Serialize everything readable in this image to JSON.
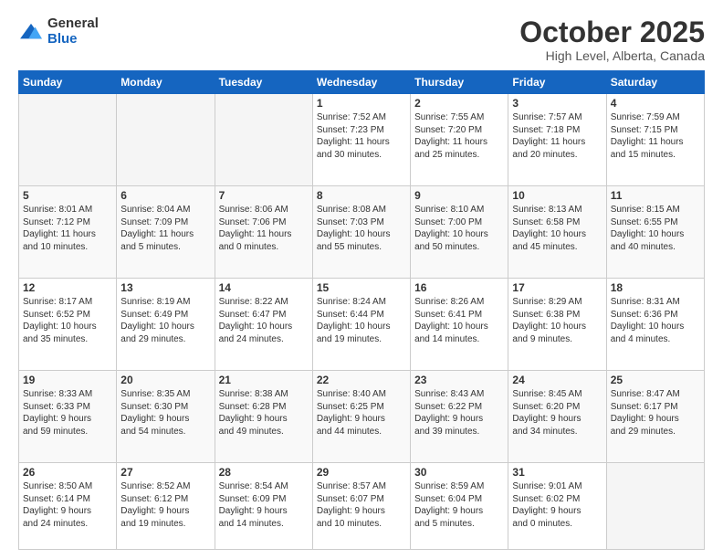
{
  "header": {
    "logo_line1": "General",
    "logo_line2": "Blue",
    "month": "October 2025",
    "location": "High Level, Alberta, Canada"
  },
  "weekdays": [
    "Sunday",
    "Monday",
    "Tuesday",
    "Wednesday",
    "Thursday",
    "Friday",
    "Saturday"
  ],
  "weeks": [
    [
      {
        "day": "",
        "info": ""
      },
      {
        "day": "",
        "info": ""
      },
      {
        "day": "",
        "info": ""
      },
      {
        "day": "1",
        "info": "Sunrise: 7:52 AM\nSunset: 7:23 PM\nDaylight: 11 hours\nand 30 minutes."
      },
      {
        "day": "2",
        "info": "Sunrise: 7:55 AM\nSunset: 7:20 PM\nDaylight: 11 hours\nand 25 minutes."
      },
      {
        "day": "3",
        "info": "Sunrise: 7:57 AM\nSunset: 7:18 PM\nDaylight: 11 hours\nand 20 minutes."
      },
      {
        "day": "4",
        "info": "Sunrise: 7:59 AM\nSunset: 7:15 PM\nDaylight: 11 hours\nand 15 minutes."
      }
    ],
    [
      {
        "day": "5",
        "info": "Sunrise: 8:01 AM\nSunset: 7:12 PM\nDaylight: 11 hours\nand 10 minutes."
      },
      {
        "day": "6",
        "info": "Sunrise: 8:04 AM\nSunset: 7:09 PM\nDaylight: 11 hours\nand 5 minutes."
      },
      {
        "day": "7",
        "info": "Sunrise: 8:06 AM\nSunset: 7:06 PM\nDaylight: 11 hours\nand 0 minutes."
      },
      {
        "day": "8",
        "info": "Sunrise: 8:08 AM\nSunset: 7:03 PM\nDaylight: 10 hours\nand 55 minutes."
      },
      {
        "day": "9",
        "info": "Sunrise: 8:10 AM\nSunset: 7:00 PM\nDaylight: 10 hours\nand 50 minutes."
      },
      {
        "day": "10",
        "info": "Sunrise: 8:13 AM\nSunset: 6:58 PM\nDaylight: 10 hours\nand 45 minutes."
      },
      {
        "day": "11",
        "info": "Sunrise: 8:15 AM\nSunset: 6:55 PM\nDaylight: 10 hours\nand 40 minutes."
      }
    ],
    [
      {
        "day": "12",
        "info": "Sunrise: 8:17 AM\nSunset: 6:52 PM\nDaylight: 10 hours\nand 35 minutes."
      },
      {
        "day": "13",
        "info": "Sunrise: 8:19 AM\nSunset: 6:49 PM\nDaylight: 10 hours\nand 29 minutes."
      },
      {
        "day": "14",
        "info": "Sunrise: 8:22 AM\nSunset: 6:47 PM\nDaylight: 10 hours\nand 24 minutes."
      },
      {
        "day": "15",
        "info": "Sunrise: 8:24 AM\nSunset: 6:44 PM\nDaylight: 10 hours\nand 19 minutes."
      },
      {
        "day": "16",
        "info": "Sunrise: 8:26 AM\nSunset: 6:41 PM\nDaylight: 10 hours\nand 14 minutes."
      },
      {
        "day": "17",
        "info": "Sunrise: 8:29 AM\nSunset: 6:38 PM\nDaylight: 10 hours\nand 9 minutes."
      },
      {
        "day": "18",
        "info": "Sunrise: 8:31 AM\nSunset: 6:36 PM\nDaylight: 10 hours\nand 4 minutes."
      }
    ],
    [
      {
        "day": "19",
        "info": "Sunrise: 8:33 AM\nSunset: 6:33 PM\nDaylight: 9 hours\nand 59 minutes."
      },
      {
        "day": "20",
        "info": "Sunrise: 8:35 AM\nSunset: 6:30 PM\nDaylight: 9 hours\nand 54 minutes."
      },
      {
        "day": "21",
        "info": "Sunrise: 8:38 AM\nSunset: 6:28 PM\nDaylight: 9 hours\nand 49 minutes."
      },
      {
        "day": "22",
        "info": "Sunrise: 8:40 AM\nSunset: 6:25 PM\nDaylight: 9 hours\nand 44 minutes."
      },
      {
        "day": "23",
        "info": "Sunrise: 8:43 AM\nSunset: 6:22 PM\nDaylight: 9 hours\nand 39 minutes."
      },
      {
        "day": "24",
        "info": "Sunrise: 8:45 AM\nSunset: 6:20 PM\nDaylight: 9 hours\nand 34 minutes."
      },
      {
        "day": "25",
        "info": "Sunrise: 8:47 AM\nSunset: 6:17 PM\nDaylight: 9 hours\nand 29 minutes."
      }
    ],
    [
      {
        "day": "26",
        "info": "Sunrise: 8:50 AM\nSunset: 6:14 PM\nDaylight: 9 hours\nand 24 minutes."
      },
      {
        "day": "27",
        "info": "Sunrise: 8:52 AM\nSunset: 6:12 PM\nDaylight: 9 hours\nand 19 minutes."
      },
      {
        "day": "28",
        "info": "Sunrise: 8:54 AM\nSunset: 6:09 PM\nDaylight: 9 hours\nand 14 minutes."
      },
      {
        "day": "29",
        "info": "Sunrise: 8:57 AM\nSunset: 6:07 PM\nDaylight: 9 hours\nand 10 minutes."
      },
      {
        "day": "30",
        "info": "Sunrise: 8:59 AM\nSunset: 6:04 PM\nDaylight: 9 hours\nand 5 minutes."
      },
      {
        "day": "31",
        "info": "Sunrise: 9:01 AM\nSunset: 6:02 PM\nDaylight: 9 hours\nand 0 minutes."
      },
      {
        "day": "",
        "info": ""
      }
    ]
  ]
}
